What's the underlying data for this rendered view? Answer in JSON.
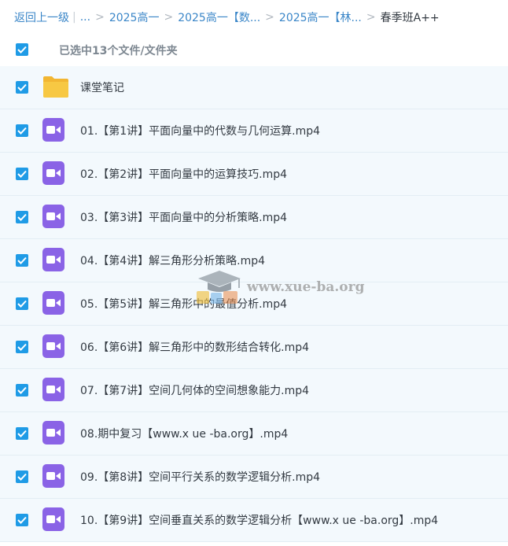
{
  "breadcrumb": {
    "back": "返回上一级",
    "ellipsis": "...",
    "items": [
      "2025高一",
      "2025高一【数...",
      "2025高一【林..."
    ],
    "current": "春季班A++"
  },
  "selection": {
    "summary": "已选中13个文件/文件夹",
    "checked": true
  },
  "files": [
    {
      "type": "folder",
      "name": "课堂笔记"
    },
    {
      "type": "video",
      "name": "01.【第1讲】平面向量中的代数与几何运算.mp4"
    },
    {
      "type": "video",
      "name": "02.【第2讲】平面向量中的运算技巧.mp4"
    },
    {
      "type": "video",
      "name": "03.【第3讲】平面向量中的分析策略.mp4"
    },
    {
      "type": "video",
      "name": "04.【第4讲】解三角形分析策略.mp4"
    },
    {
      "type": "video",
      "name": "05.【第5讲】解三角形中的最值分析.mp4"
    },
    {
      "type": "video",
      "name": "06.【第6讲】解三角形中的数形结合转化.mp4"
    },
    {
      "type": "video",
      "name": "07.【第7讲】空间几何体的空间想象能力.mp4"
    },
    {
      "type": "video",
      "name": "08.期中复习【www.x ue -ba.org】.mp4"
    },
    {
      "type": "video",
      "name": "09.【第8讲】空间平行关系的数学逻辑分析.mp4"
    },
    {
      "type": "video",
      "name": "10.【第9讲】空间垂直关系的数学逻辑分析【www.x ue -ba.org】.mp4"
    }
  ],
  "watermark": {
    "text": "www.xue-ba.org"
  },
  "colors": {
    "accent": "#1f9be6",
    "link": "#3a86c8",
    "video_icon": "#8a63e6",
    "folder_icon": "#f7c843",
    "row_bg": "#f3f9fd"
  }
}
